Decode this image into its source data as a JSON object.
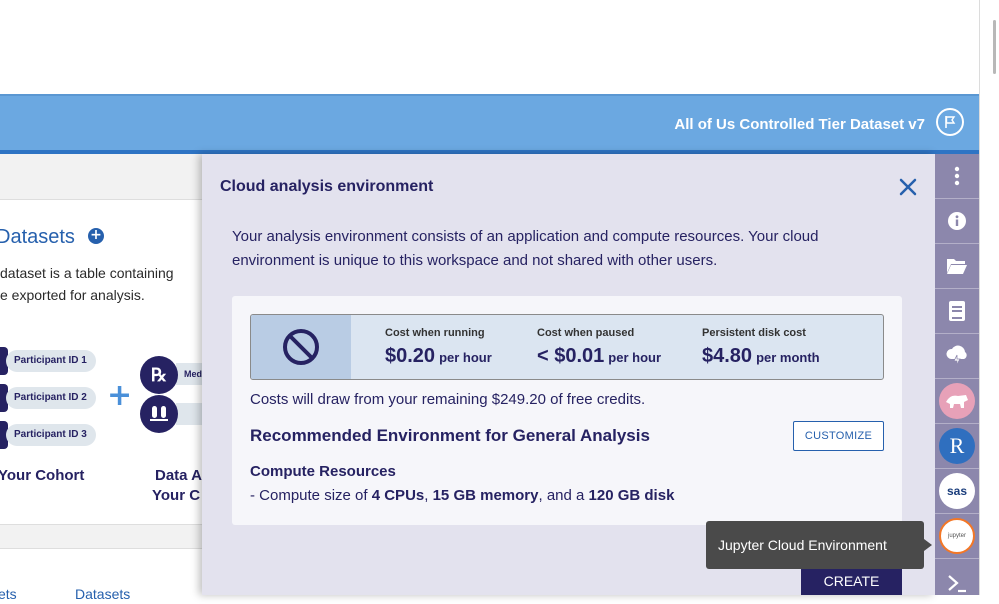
{
  "header": {
    "dataset_title": "All of Us Controlled Tier Dataset v7"
  },
  "background": {
    "datasets_heading": "Datasets",
    "desc_line1": "dataset is a table containing",
    "desc_line2": "e exported for analysis.",
    "participants": [
      "Participant ID 1",
      "Participant ID 2",
      "Participant ID 3"
    ],
    "med_label": "Med",
    "cohort_label": "Your Cohort",
    "data_label_line1": "Data A",
    "data_label_line2": "Your C",
    "link_left": "ets",
    "link_right": "Datasets",
    "rx_glyph": "℞"
  },
  "panel": {
    "title": "Cloud analysis environment",
    "intro": "Your analysis environment consists of an application and compute resources. Your cloud environment is unique to this workspace and not shared with other users.",
    "costs": [
      {
        "label": "Cost when running",
        "amount": "$0.20",
        "unit": "per hour"
      },
      {
        "label": "Cost when paused",
        "amount": "< $0.01",
        "unit": "per hour"
      },
      {
        "label": "Persistent disk cost",
        "amount": "$4.80",
        "unit": "per month"
      }
    ],
    "credits_text": "Costs will draw from your remaining $249.20 of free credits.",
    "recommended_title": "Recommended Environment for General Analysis",
    "customize_label": "CUSTOMIZE",
    "compute_title": "Compute Resources",
    "compute_prefix": "- Compute size of ",
    "compute_cpus": "4 CPUs",
    "compute_sep1": ", ",
    "compute_memory": "15 GB memory",
    "compute_sep2": ", and a ",
    "compute_disk": "120 GB disk",
    "create_label": "CREATE"
  },
  "tooltip": {
    "text": "Jupyter Cloud Environment"
  },
  "iconbar": {
    "r_label": "R",
    "sas_label": "sas",
    "jupyter_label": "jupyter",
    "items": [
      "more-icon",
      "info-icon",
      "folder-icon",
      "notebook-icon",
      "cloud-icon",
      "cromwell-icon",
      "r-icon",
      "sas-icon",
      "jupyter-icon",
      "terminal-icon"
    ]
  },
  "colors": {
    "header": "#6ba8e1",
    "navy": "#262262",
    "panel_bg": "#e3e2ee",
    "iconbar": "#8c87ac",
    "link_blue": "#2660ad"
  }
}
